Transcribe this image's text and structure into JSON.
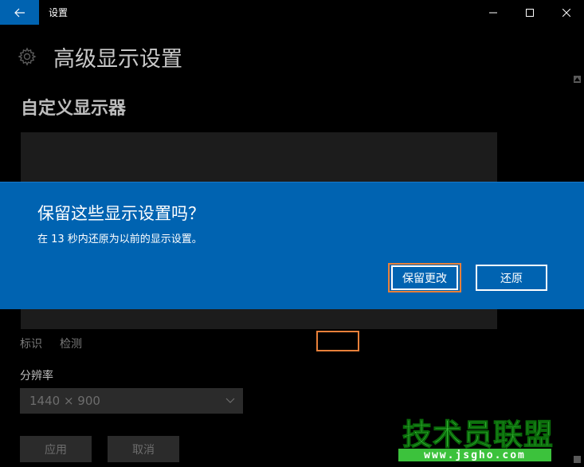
{
  "window": {
    "app_title": "设置"
  },
  "page": {
    "title": "高级显示设置",
    "section_title": "自定义显示器",
    "identify_link": "标识",
    "detect_link": "检测",
    "resolution_label": "分辨率",
    "resolution_value": "1440 × 900",
    "apply_button": "应用",
    "cancel_button": "取消"
  },
  "dialog": {
    "title": "保留这些显示设置吗？",
    "message": "在 13 秒内还原为以前的显示设置。",
    "keep_button": "保留更改",
    "revert_button": "还原"
  },
  "watermark": {
    "text": "技术员联盟",
    "url": "www.jsgho.com"
  },
  "colors": {
    "accent": "#0063b1",
    "highlight": "#e8803a",
    "watermark": "#3cc23c"
  },
  "icons": [
    "back-arrow-icon",
    "minimize-icon",
    "maximize-icon",
    "close-icon",
    "gear-icon",
    "chevron-down-icon"
  ]
}
